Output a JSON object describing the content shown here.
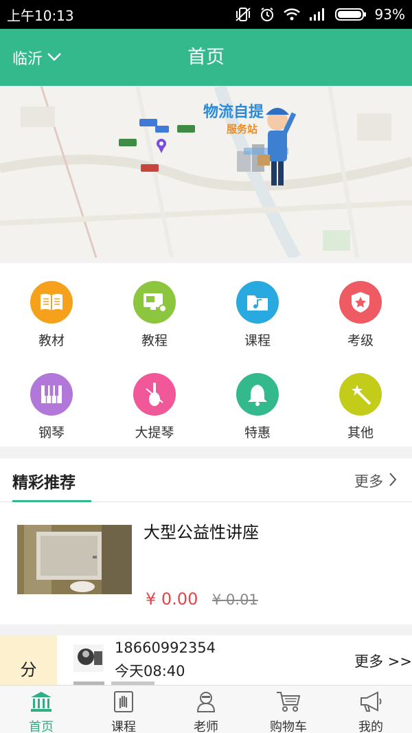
{
  "status_bar": {
    "time": "上午10:13",
    "battery": "93%"
  },
  "header": {
    "city": "临沂",
    "title": "首页"
  },
  "banner": {
    "heading": "物流自提",
    "subheading": "服务站"
  },
  "categories": [
    {
      "label": "教材",
      "icon": "book-icon",
      "color": "#f5a11c"
    },
    {
      "label": "教程",
      "icon": "monitor-icon",
      "color": "#8cc63e"
    },
    {
      "label": "课程",
      "icon": "music-folder-icon",
      "color": "#28a9e0"
    },
    {
      "label": "考级",
      "icon": "star-shield-icon",
      "color": "#ef5b63"
    },
    {
      "label": "钢琴",
      "icon": "piano-icon",
      "color": "#b278d9"
    },
    {
      "label": "大提琴",
      "icon": "cello-icon",
      "color": "#f0589a"
    },
    {
      "label": "特惠",
      "icon": "bell-icon",
      "color": "#33b98c"
    },
    {
      "label": "其他",
      "icon": "magic-wand-icon",
      "color": "#c4cc1a"
    }
  ],
  "recommend": {
    "tab_title": "精彩推荐",
    "more_label": "更多",
    "item": {
      "title": "大型公益性讲座",
      "price": "¥ 0.00",
      "original_price": "¥ 0.01"
    }
  },
  "feed": {
    "tag": "分",
    "phone": "18660992354",
    "time": "今天08:40",
    "more_label": "更多 >>"
  },
  "bottom_tabs": [
    {
      "label": "首页",
      "icon": "bank-icon",
      "active": true
    },
    {
      "label": "课程",
      "icon": "hand-book-icon",
      "active": false
    },
    {
      "label": "老师",
      "icon": "teacher-icon",
      "active": false
    },
    {
      "label": "购物车",
      "icon": "cart-icon",
      "active": false
    },
    {
      "label": "我的",
      "icon": "megaphone-icon",
      "active": false
    }
  ],
  "colors": {
    "brand": "#33b98c",
    "price": "#e8424a",
    "tag_bg": "#fdf0cf"
  }
}
